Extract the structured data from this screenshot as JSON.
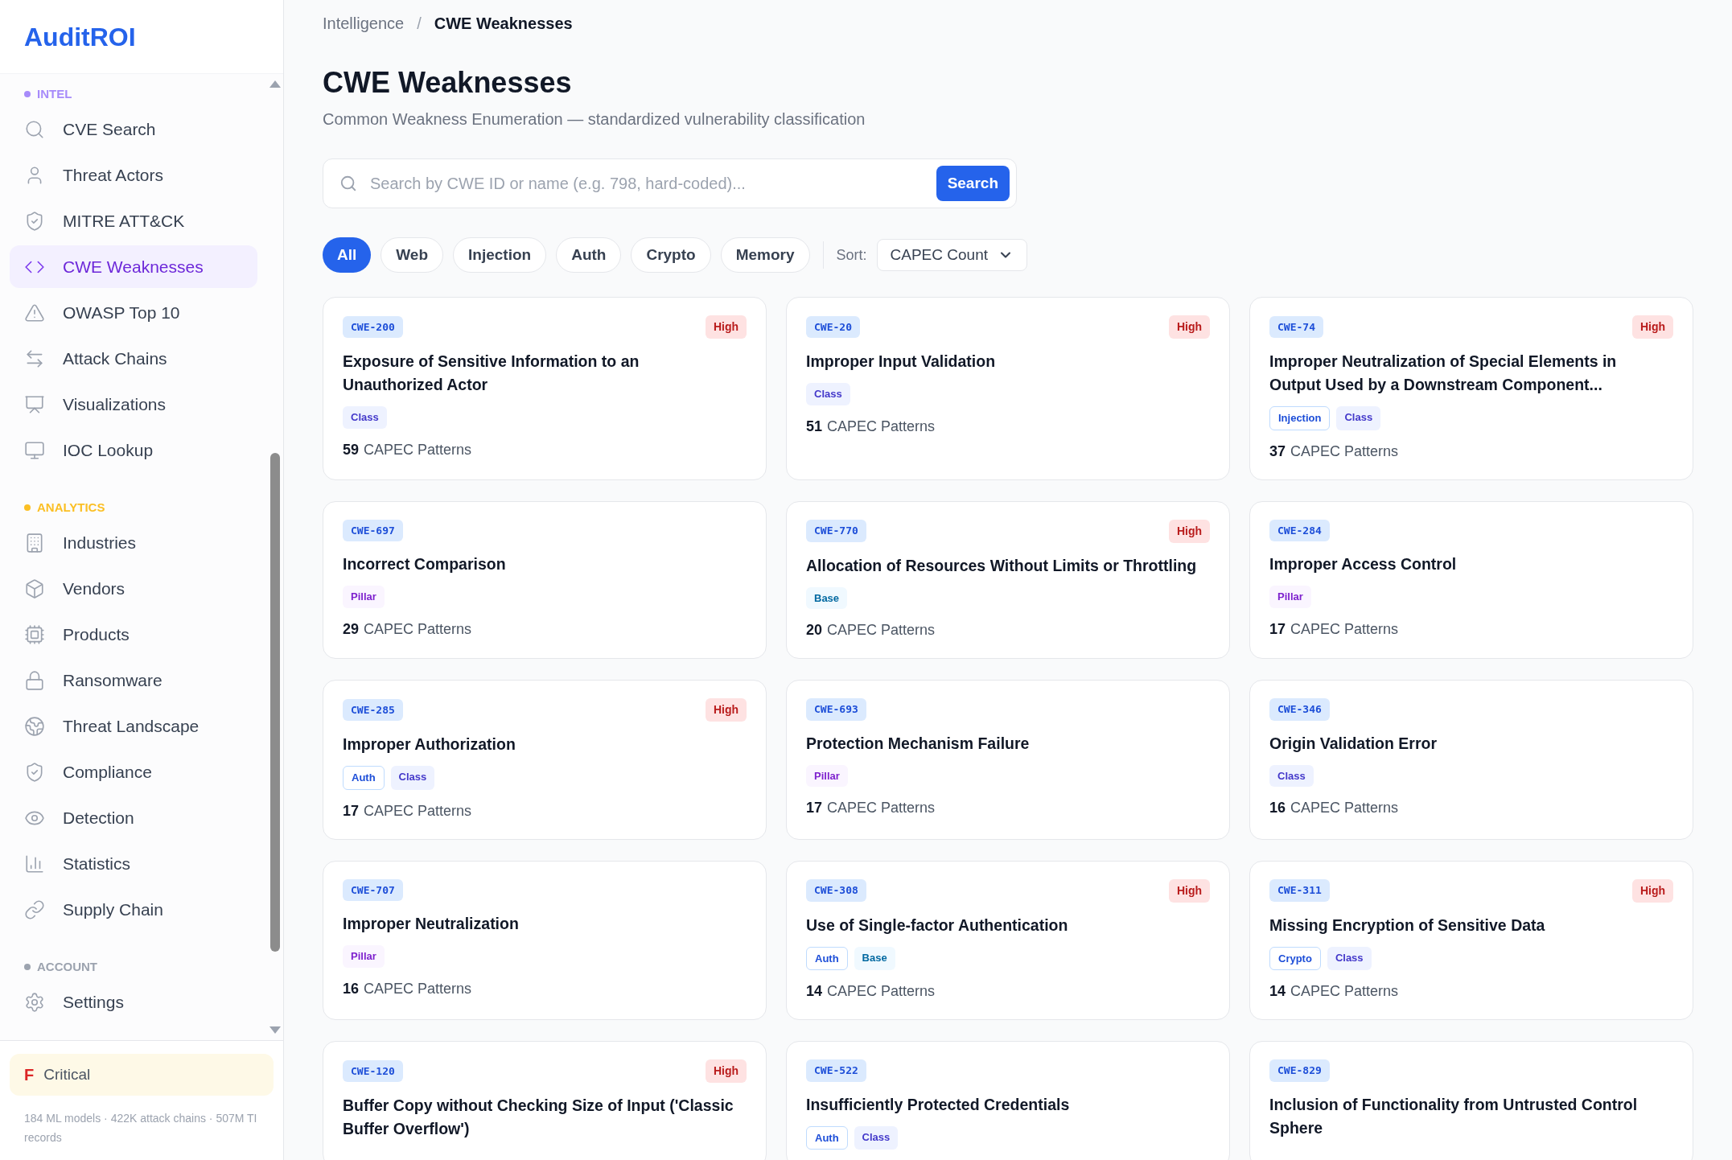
{
  "brand": "AuditROI",
  "sidebar": {
    "sections": [
      {
        "title": "INTEL",
        "color": "#a78bfa",
        "items": [
          {
            "label": "CVE Search",
            "selected": false
          },
          {
            "label": "Threat Actors",
            "selected": false
          },
          {
            "label": "MITRE ATT&CK",
            "selected": false
          },
          {
            "label": "CWE Weaknesses",
            "selected": true
          },
          {
            "label": "OWASP Top 10",
            "selected": false
          },
          {
            "label": "Attack Chains",
            "selected": false
          },
          {
            "label": "Visualizations",
            "selected": false
          },
          {
            "label": "IOC Lookup",
            "selected": false
          }
        ]
      },
      {
        "title": "ANALYTICS",
        "color": "#fbbf24",
        "items": [
          {
            "label": "Industries",
            "selected": false
          },
          {
            "label": "Vendors",
            "selected": false
          },
          {
            "label": "Products",
            "selected": false
          },
          {
            "label": "Ransomware",
            "selected": false
          },
          {
            "label": "Threat Landscape",
            "selected": false
          },
          {
            "label": "Compliance",
            "selected": false
          },
          {
            "label": "Detection",
            "selected": false
          },
          {
            "label": "Statistics",
            "selected": false
          },
          {
            "label": "Supply Chain",
            "selected": false
          }
        ]
      },
      {
        "title": "ACCOUNT",
        "color": "#9ca3af",
        "items": [
          {
            "label": "Settings",
            "selected": false
          }
        ]
      }
    ],
    "grade": {
      "letter": "F",
      "label": "Critical"
    },
    "footer": "184 ML models · 422K attack chains · 507M TI records"
  },
  "breadcrumb": [
    "Intelligence",
    "CWE Weaknesses"
  ],
  "breadcrumb_separator": "/",
  "title": "CWE Weaknesses",
  "subtitle": "Common Weakness Enumeration — standardized vulnerability classification",
  "search": {
    "placeholder": "Search by CWE ID or name (e.g. 798, hard-coded)...",
    "button": "Search"
  },
  "filters": [
    {
      "label": "All",
      "selected": true
    },
    {
      "label": "Web",
      "selected": false
    },
    {
      "label": "Injection",
      "selected": false
    },
    {
      "label": "Auth",
      "selected": false
    },
    {
      "label": "Crypto",
      "selected": false
    },
    {
      "label": "Memory",
      "selected": false
    }
  ],
  "sort": {
    "label": "Sort:",
    "value": "CAPEC Count"
  },
  "cards": [
    {
      "id": "CWE-200",
      "severity": "High",
      "title": "Exposure of Sensitive Information to an Unauthorized Actor",
      "tags": [
        {
          "label": "Class",
          "kind": "class"
        }
      ],
      "count": "59",
      "count_label": "CAPEC Patterns"
    },
    {
      "id": "CWE-20",
      "severity": "High",
      "title": "Improper Input Validation",
      "tags": [
        {
          "label": "Class",
          "kind": "class"
        }
      ],
      "count": "51",
      "count_label": "CAPEC Patterns"
    },
    {
      "id": "CWE-74",
      "severity": "High",
      "title": "Improper Neutralization of Special Elements in Output Used by a Downstream Component...",
      "tags": [
        {
          "label": "Injection",
          "kind": "category"
        },
        {
          "label": "Class",
          "kind": "class"
        }
      ],
      "count": "37",
      "count_label": "CAPEC Patterns"
    },
    {
      "id": "CWE-697",
      "title": "Incorrect Comparison",
      "tags": [
        {
          "label": "Pillar",
          "kind": "pillar"
        }
      ],
      "count": "29",
      "count_label": "CAPEC Patterns"
    },
    {
      "id": "CWE-770",
      "severity": "High",
      "title": "Allocation of Resources Without Limits or Throttling",
      "tags": [
        {
          "label": "Base",
          "kind": "base"
        }
      ],
      "count": "20",
      "count_label": "CAPEC Patterns"
    },
    {
      "id": "CWE-284",
      "title": "Improper Access Control",
      "tags": [
        {
          "label": "Pillar",
          "kind": "pillar"
        }
      ],
      "count": "17",
      "count_label": "CAPEC Patterns"
    },
    {
      "id": "CWE-285",
      "severity": "High",
      "title": "Improper Authorization",
      "tags": [
        {
          "label": "Auth",
          "kind": "category"
        },
        {
          "label": "Class",
          "kind": "class"
        }
      ],
      "count": "17",
      "count_label": "CAPEC Patterns"
    },
    {
      "id": "CWE-693",
      "title": "Protection Mechanism Failure",
      "tags": [
        {
          "label": "Pillar",
          "kind": "pillar"
        }
      ],
      "count": "17",
      "count_label": "CAPEC Patterns"
    },
    {
      "id": "CWE-346",
      "title": "Origin Validation Error",
      "tags": [
        {
          "label": "Class",
          "kind": "class"
        }
      ],
      "count": "16",
      "count_label": "CAPEC Patterns"
    },
    {
      "id": "CWE-707",
      "title": "Improper Neutralization",
      "tags": [
        {
          "label": "Pillar",
          "kind": "pillar"
        }
      ],
      "count": "16",
      "count_label": "CAPEC Patterns"
    },
    {
      "id": "CWE-308",
      "severity": "High",
      "title": "Use of Single-factor Authentication",
      "tags": [
        {
          "label": "Auth",
          "kind": "category"
        },
        {
          "label": "Base",
          "kind": "base"
        }
      ],
      "count": "14",
      "count_label": "CAPEC Patterns"
    },
    {
      "id": "CWE-311",
      "severity": "High",
      "title": "Missing Encryption of Sensitive Data",
      "tags": [
        {
          "label": "Crypto",
          "kind": "category"
        },
        {
          "label": "Class",
          "kind": "class"
        }
      ],
      "count": "14",
      "count_label": "CAPEC Patterns"
    },
    {
      "id": "CWE-120",
      "severity": "High",
      "title": "Buffer Copy without Checking Size of Input ('Classic Buffer Overflow')"
    },
    {
      "id": "CWE-522",
      "title": "Insufficiently Protected Credentials",
      "tags": [
        {
          "label": "Auth",
          "kind": "category"
        },
        {
          "label": "Class",
          "kind": "class"
        }
      ]
    },
    {
      "id": "CWE-829",
      "title": "Inclusion of Functionality from Untrusted Control Sphere"
    }
  ]
}
